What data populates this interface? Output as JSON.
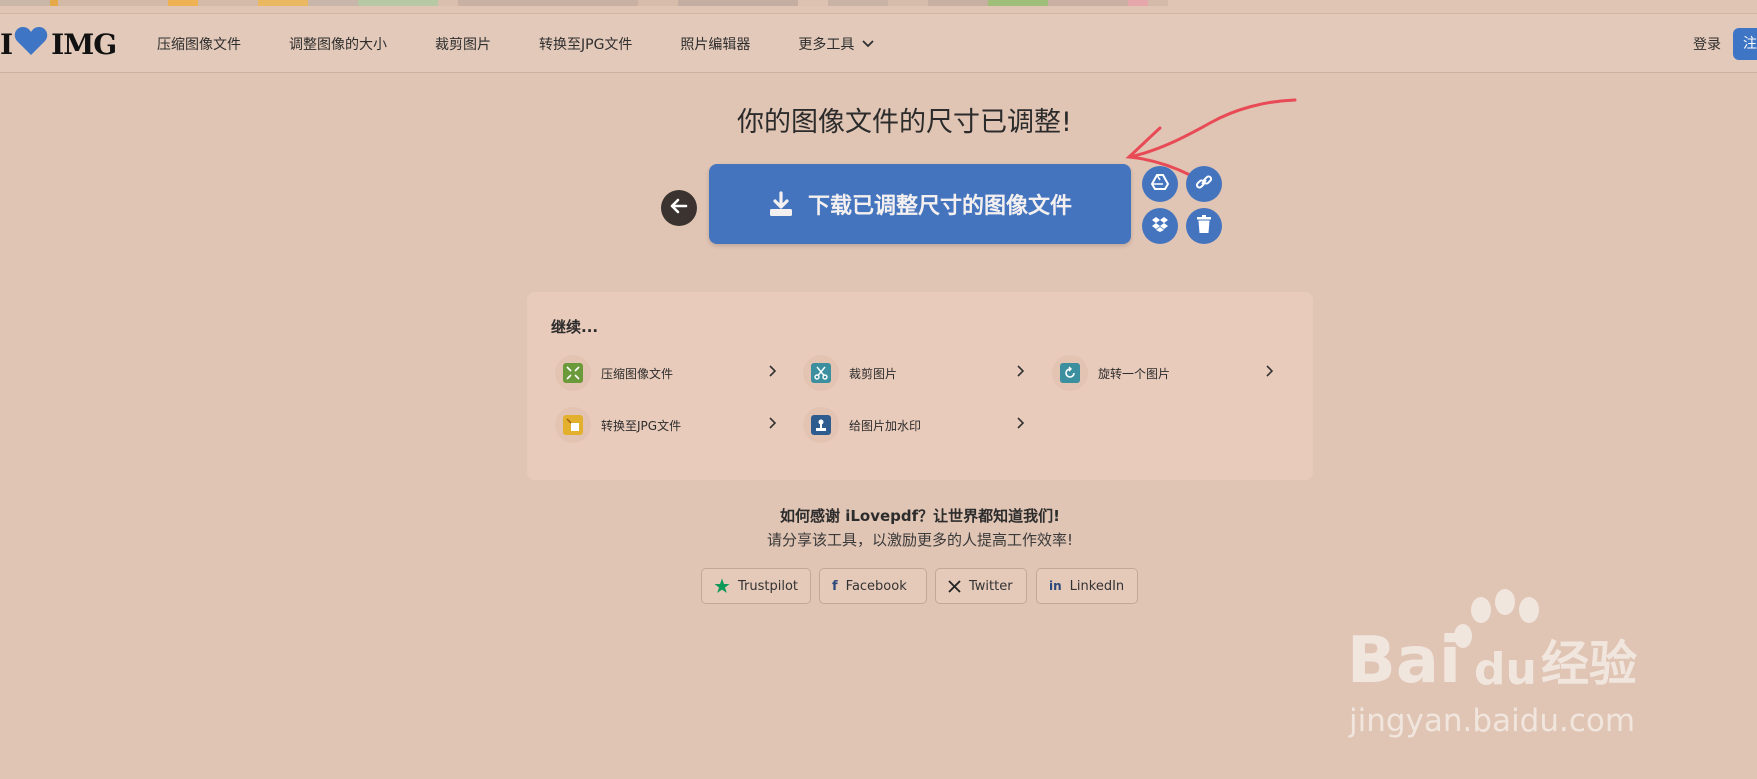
{
  "header": {
    "logo_left": "I",
    "logo_right": "IMG",
    "nav": [
      "压缩图像文件",
      "调整图像的大小",
      "裁剪图片",
      "转换至JPG文件",
      "照片编辑器",
      "更多工具"
    ],
    "login": "登录",
    "signup": "注"
  },
  "main": {
    "title": "你的图像文件的尺寸已调整!",
    "download_label": "下载已调整尺寸的图像文件"
  },
  "continue_panel": {
    "title": "继续...",
    "tools": [
      {
        "label": "压缩图像文件",
        "color": "#6a9a3a"
      },
      {
        "label": "裁剪图片",
        "color": "#3b8f9e"
      },
      {
        "label": "旋转一个图片",
        "color": "#3b8f9e"
      },
      {
        "label": "转换至JPG文件",
        "color": "#e3b02e"
      },
      {
        "label": "给图片加水印",
        "color": "#2f5c8f"
      }
    ]
  },
  "share": {
    "line1": "如何感谢 iLovepdf？让世界都知道我们!",
    "line2": "请分享该工具，以激励更多的人提高工作效率!",
    "buttons": [
      "Trustpilot",
      "Facebook",
      "Twitter",
      "LinkedIn"
    ]
  },
  "watermark": {
    "brand": "Bai",
    "brand2": "du",
    "cn": "经验",
    "url": "jingyan.baidu.com"
  },
  "colors": {
    "background": "#e0c4b4",
    "accent": "#4474be",
    "annotation_arrow": "#e84b55"
  }
}
